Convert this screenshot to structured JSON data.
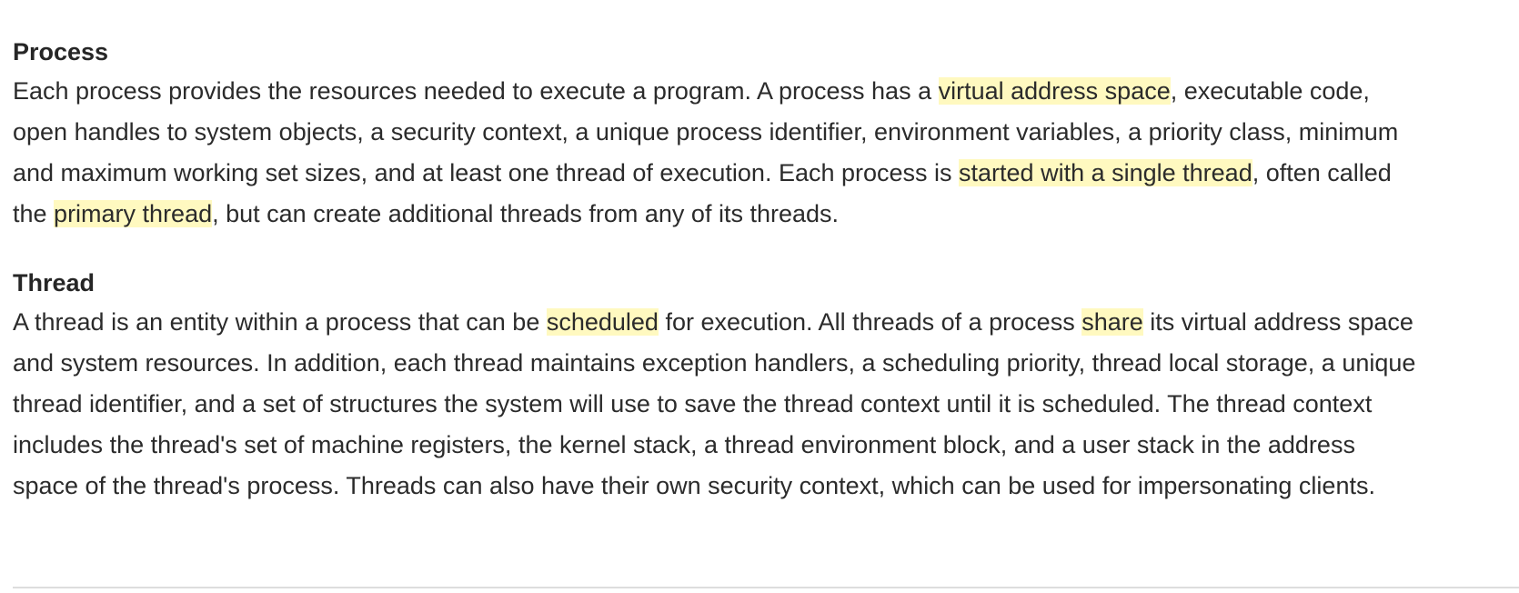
{
  "process": {
    "title": "Process",
    "segments": [
      {
        "text": "Each process provides the resources needed to execute a program. A process has a ",
        "highlight": false
      },
      {
        "text": "virtual address space",
        "highlight": true
      },
      {
        "text": ", executable code, open handles to system objects, a security context, a unique process identifier, environment variables, a priority class, minimum and maximum working set sizes, and at least one thread of execution. Each process is ",
        "highlight": false
      },
      {
        "text": "started with a single thread",
        "highlight": true
      },
      {
        "text": ", often called the ",
        "highlight": false
      },
      {
        "text": "primary thread",
        "highlight": true
      },
      {
        "text": ", but can create additional threads from any of its threads.",
        "highlight": false
      }
    ]
  },
  "thread": {
    "title": "Thread",
    "segments": [
      {
        "text": "A thread is an entity within a process that can be ",
        "highlight": false
      },
      {
        "text": "scheduled",
        "highlight": true
      },
      {
        "text": " for execution. All threads of a process ",
        "highlight": false
      },
      {
        "text": "share",
        "highlight": true
      },
      {
        "text": " its virtual address space and system resources. In addition, each thread maintains exception handlers, a scheduling priority, thread local storage, a unique thread identifier, and a set of structures the system will use to save the thread context until it is scheduled. The thread context includes the thread's set of machine registers, the kernel stack, a thread environment block, and a user stack in the address space of the thread's process. Threads can also have their own security context, which can be used for impersonating clients.",
        "highlight": false
      }
    ]
  },
  "colors": {
    "highlight": "#fff9c0",
    "text": "#2b2b2b",
    "divider": "#dddddd"
  }
}
